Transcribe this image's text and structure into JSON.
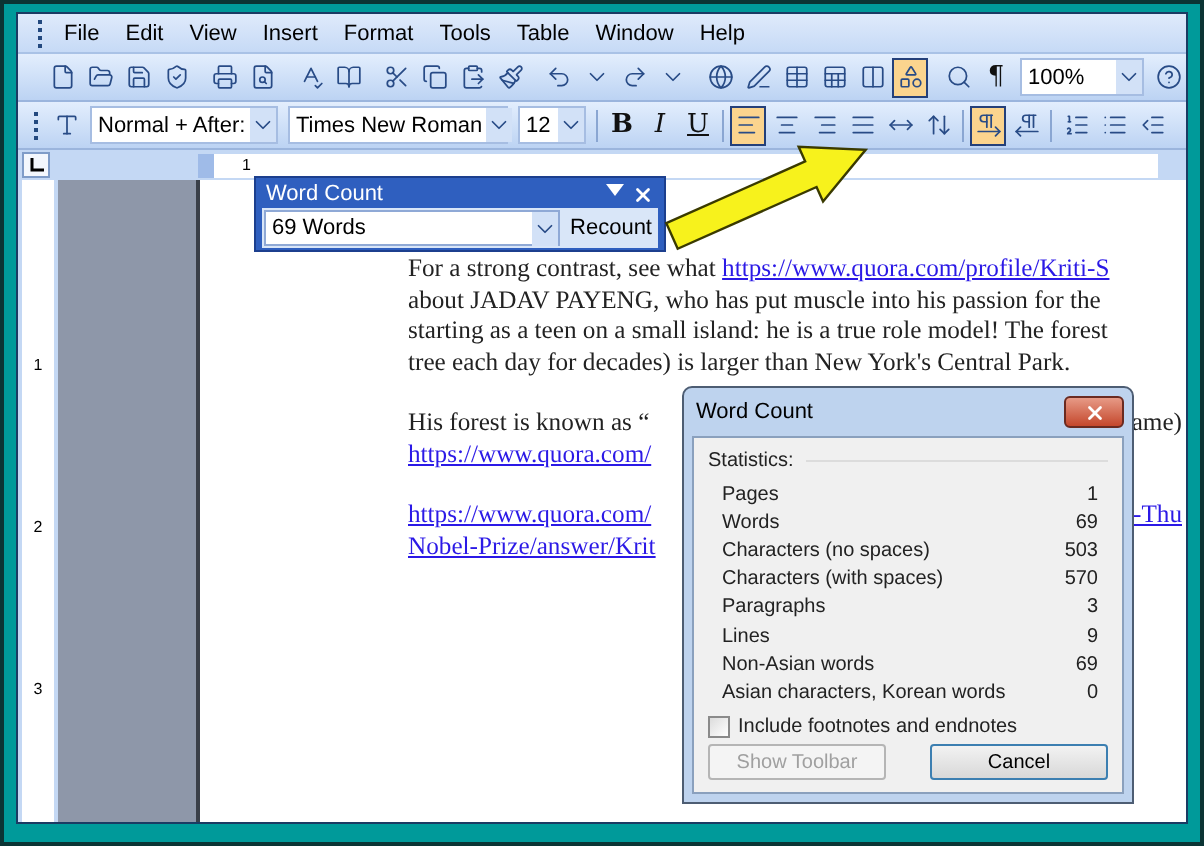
{
  "menu": [
    "File",
    "Edit",
    "View",
    "Insert",
    "Format",
    "Tools",
    "Table",
    "Window",
    "Help"
  ],
  "standard_toolbar": {
    "drawing_button": {
      "selected": true
    },
    "marks_label": "¶",
    "zoom": "100%"
  },
  "formatting_toolbar": {
    "style": "Normal + After:",
    "font": "Times New Roman",
    "size": "12",
    "style_buttons": [
      {
        "label": "B",
        "selected": false
      },
      {
        "label": "I",
        "selected": false
      },
      {
        "label": "U",
        "selected": false
      }
    ],
    "align_buttons": [
      {
        "selected": true
      },
      {
        "selected": false
      },
      {
        "selected": false
      },
      {
        "selected": false
      },
      {
        "selected": false
      }
    ],
    "direction_buttons": [
      {
        "selected": true
      },
      {
        "selected": false
      }
    ]
  },
  "horizontal_ruler": {
    "labels": [
      "1"
    ]
  },
  "vertical_ruler": {
    "labels": [
      "1",
      "2",
      "3"
    ]
  },
  "document": {
    "paragraphs": [
      {
        "lines": [
          {
            "parts": [
              {
                "text": "For a strong contrast, see what ",
                "link": false
              },
              {
                "text": "https://www.quora.com/profile/Kriti-S",
                "link": true
              }
            ]
          },
          {
            "parts": [
              {
                "text": "about JADAV PAYENG, who has put muscle into his passion for the",
                "link": false
              }
            ]
          },
          {
            "parts": [
              {
                "text": "starting as a teen on a small island: he is a true role model! The forest",
                "link": false
              }
            ]
          },
          {
            "parts": [
              {
                "text": "tree each day for decades) is larger than New York's Central Park.",
                "link": false
              }
            ]
          }
        ]
      },
      {
        "lines": [
          {
            "parts": [
              {
                "text": "His forest is known as “",
                "link": false
              }
            ],
            "after": [
              {
                "text": "ame)",
                "link": false
              }
            ]
          },
          {
            "parts": [
              {
                "text": "https://www.quora.com/",
                "link": true
              }
            ]
          }
        ]
      },
      {
        "lines": [
          {
            "parts": [
              {
                "text": "https://www.quora.com/",
                "link": true
              }
            ],
            "after": [
              {
                "text": "-Thu",
                "link": true
              }
            ]
          },
          {
            "parts": [
              {
                "text": "Nobel-Prize/answer/Krit",
                "link": true
              }
            ]
          }
        ]
      }
    ]
  },
  "floating_toolbar": {
    "title": "Word Count",
    "count": "69 Words",
    "button": "Recount"
  },
  "dialog": {
    "title": "Word Count",
    "section": "Statistics:",
    "stats": [
      {
        "label": "Pages",
        "value": "1"
      },
      {
        "label": "Words",
        "value": "69"
      },
      {
        "label": "Characters (no spaces)",
        "value": "503"
      },
      {
        "label": "Characters (with spaces)",
        "value": "570"
      },
      {
        "label": "Paragraphs",
        "value": "3"
      },
      {
        "label": "Lines",
        "value": "9"
      },
      {
        "label": "Non-Asian words",
        "value": "69"
      },
      {
        "label": "Asian characters, Korean words",
        "value": "0"
      }
    ],
    "checkbox": {
      "label": "Include footnotes and endnotes",
      "checked": false
    },
    "buttons": [
      {
        "label": "Show Toolbar",
        "disabled": true
      },
      {
        "label": "Cancel",
        "disabled": false
      }
    ]
  }
}
